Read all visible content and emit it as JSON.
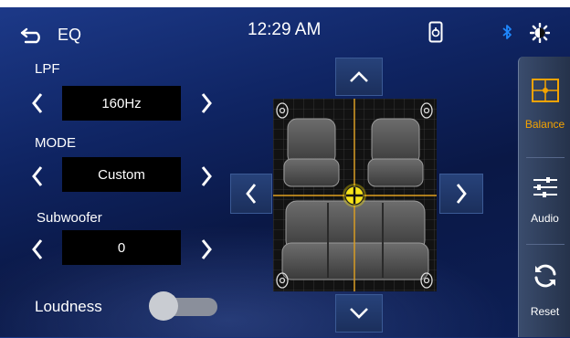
{
  "header": {
    "title": "EQ",
    "time": "12:29 AM"
  },
  "lpf": {
    "label": "LPF",
    "value": "160Hz"
  },
  "mode": {
    "label": "MODE",
    "value": "Custom"
  },
  "subwoofer": {
    "label": "Subwoofer",
    "value": "0"
  },
  "loudness": {
    "label": "Loudness",
    "enabled": false
  },
  "side_menu": [
    {
      "label": "Balance",
      "icon": "balance-icon",
      "active": true
    },
    {
      "label": "Audio",
      "icon": "sliders-icon",
      "active": false
    },
    {
      "label": "Reset",
      "icon": "reset-icon",
      "active": false
    }
  ],
  "colors": {
    "accent": "#f5a300",
    "crosshair": "#e0a020",
    "background": "#0f2462",
    "bluetooth": "#1e88ff"
  }
}
